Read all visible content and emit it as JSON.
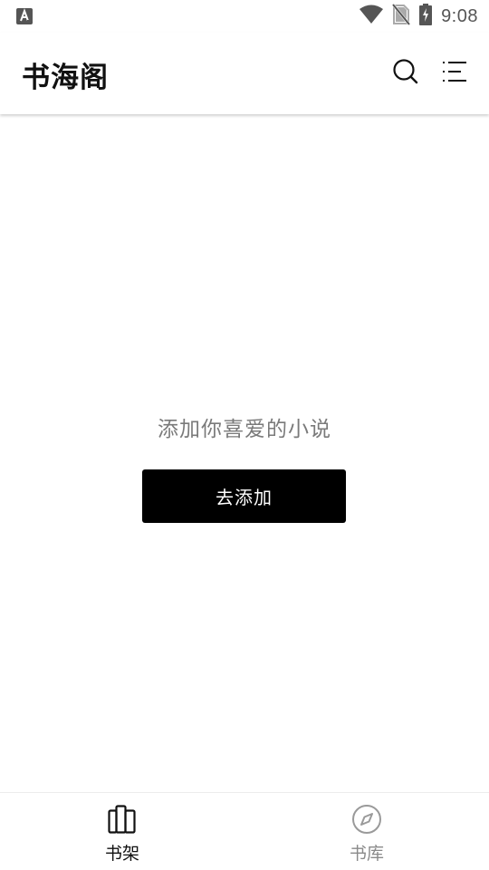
{
  "status_bar": {
    "time": "9:08",
    "icons": [
      "keyboard-a-icon",
      "wifi-icon",
      "no-sim-icon",
      "battery-charging-icon"
    ]
  },
  "app_bar": {
    "title": "书海阁",
    "icons": [
      "search-icon",
      "menu-list-icon"
    ]
  },
  "main": {
    "empty_hint": "添加你喜爱的小说",
    "add_button_label": "去添加"
  },
  "bottom_nav": {
    "items": [
      {
        "label": "书架",
        "icon": "bookshelf-icon",
        "active": true
      },
      {
        "label": "书库",
        "icon": "compass-icon",
        "active": false
      }
    ]
  },
  "colors": {
    "accent": "#000000",
    "active_nav": "#111111",
    "inactive_nav": "#8a8a8a",
    "hint_text": "#7a7a7a"
  }
}
